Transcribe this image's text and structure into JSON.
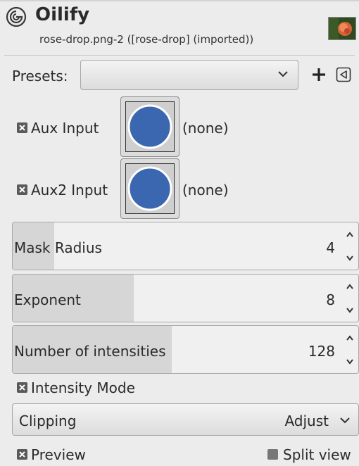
{
  "header": {
    "title": "Oilify",
    "subtitle": "rose-drop.png-2 ([rose-drop] (imported))"
  },
  "presets": {
    "label": "Presets:",
    "value": ""
  },
  "aux_input": {
    "label": "Aux Input",
    "value": "(none)",
    "checked": true
  },
  "aux2_input": {
    "label": "Aux2 Input",
    "value": "(none)",
    "checked": true
  },
  "mask_radius": {
    "label": "Mask Radius",
    "value": "4",
    "fill_fraction": 0.12
  },
  "exponent": {
    "label": "Exponent",
    "value": "8",
    "fill_fraction": 0.35
  },
  "intensities": {
    "label": "Number of intensities",
    "value": "128",
    "fill_fraction": 0.46
  },
  "intensity_mode": {
    "label": "Intensity Mode",
    "checked": true
  },
  "clipping": {
    "label": "Clipping",
    "value": "Adjust"
  },
  "preview": {
    "label": "Preview",
    "checked": true
  },
  "split_view": {
    "label": "Split view",
    "checked": false
  },
  "colors": {
    "accent_blue": "#3a67b0",
    "checkbox": "#5a5a5a"
  }
}
